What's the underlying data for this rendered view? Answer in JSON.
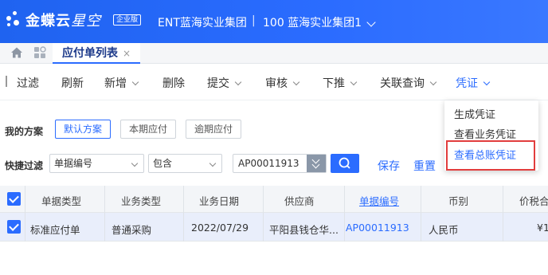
{
  "header": {
    "brand": "金蝶云",
    "brand_sub": "星空",
    "edition": "企业版",
    "org_name": "ENT蓝海实业集团",
    "separator": "|",
    "org_unit": "100 蓝海实业集团1"
  },
  "tabs": [
    {
      "label": "应付单列表",
      "close": "×"
    }
  ],
  "toolbar": {
    "items": [
      "过滤",
      "刷新",
      "新增",
      "删除",
      "提交",
      "审核",
      "下推",
      "关联查询",
      "凭证"
    ]
  },
  "voucher_menu": {
    "items": [
      "生成凭证",
      "查看业务凭证",
      "查看总账凭证"
    ],
    "highlighted": "查看总账凭证"
  },
  "scheme": {
    "label": "我的方案",
    "options": [
      "默认方案",
      "本期应付",
      "逾期应付"
    ],
    "active": "默认方案"
  },
  "quick_filter": {
    "label": "快捷过滤",
    "field": "单据编号",
    "operator": "包含",
    "value": "AP00011913",
    "save": "保存",
    "reset": "重置"
  },
  "table": {
    "columns": [
      "单据类型",
      "业务类型",
      "业务日期",
      "供应商",
      "单据编号",
      "币别",
      "价税合"
    ],
    "rows": [
      [
        "标准应付单",
        "普通采购",
        "2022/07/29",
        "平阳县钱仓华...",
        "AP00011913",
        "人民币",
        "¥1"
      ]
    ]
  },
  "colors": {
    "primary": "#2b6cff",
    "header_bg": "#1f63f0",
    "highlight_border": "#e23d3d",
    "selected_row": "#e9eefb"
  }
}
